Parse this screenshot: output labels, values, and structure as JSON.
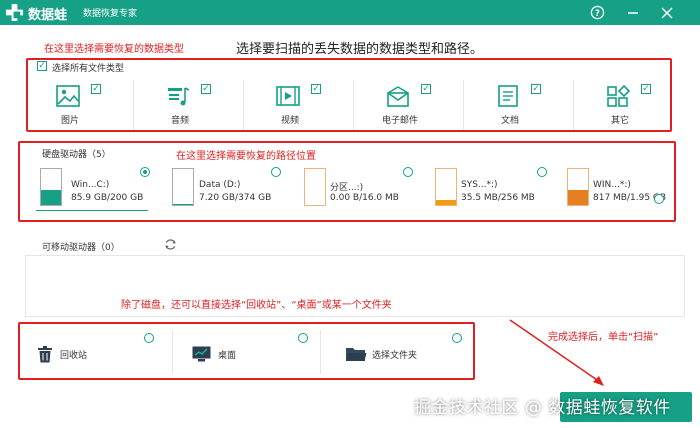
{
  "app": {
    "name": "数据蛙",
    "subtitle": "数据恢复专家",
    "controls": [
      "help-icon",
      "minimize-icon",
      "close-icon"
    ],
    "brand_color": "#16a085"
  },
  "heading": "选择要扫描的丢失数据的数据类型和路径。",
  "annotations": {
    "type_hint": "在这里选择需要恢复的数据类型",
    "path_hint": "在这里选择需要恢复的路径位置",
    "location_hint": "除了磁盘，还可以直接选择“回收站”、“桌面”或某一个文件夹",
    "scan_hint": "完成选择后，单击“扫描”",
    "color": "#e02020"
  },
  "file_types": {
    "select_all_label": "选择所有文件类型",
    "select_all_checked": true,
    "items": [
      {
        "label": "图片",
        "icon": "image-icon",
        "checked": true
      },
      {
        "label": "音频",
        "icon": "music-icon",
        "checked": true
      },
      {
        "label": "视频",
        "icon": "video-icon",
        "checked": true
      },
      {
        "label": "电子邮件",
        "icon": "email-icon",
        "checked": true
      },
      {
        "label": "文档",
        "icon": "document-icon",
        "checked": true
      },
      {
        "label": "其它",
        "icon": "other-icon",
        "checked": true
      }
    ]
  },
  "hard_drives": {
    "title": "硬盘驱动器（5）",
    "items": [
      {
        "name": "Win...C:)",
        "size": "85.9 GB/200 GB",
        "used_fraction": 0.43,
        "fill_color": "#16a085",
        "selected": true
      },
      {
        "name": "Data (D:)",
        "size": "7.20 GB/374 GB",
        "used_fraction": 0.02,
        "fill_color": "#16a085",
        "selected": false
      },
      {
        "name": "分区...:)",
        "size": "0.00  B/16.0 MB",
        "used_fraction": 0.0,
        "fill_color": "#16a085",
        "selected": false
      },
      {
        "name": "SYS...*:)",
        "size": "35.5 MB/256 MB",
        "used_fraction": 0.14,
        "fill_color": "#f39c12",
        "selected": false
      },
      {
        "name": "WIN...*:)",
        "size": "817 MB/1.95 GB",
        "used_fraction": 0.42,
        "fill_color": "#e67e22",
        "selected": false
      }
    ]
  },
  "removable": {
    "title": "可移动驱动器（0）",
    "refresh_icon": "refresh-icon"
  },
  "locations": [
    {
      "label": "回收站",
      "icon": "recycle-bin-icon",
      "selected": false
    },
    {
      "label": "桌面",
      "icon": "desktop-icon",
      "selected": false
    },
    {
      "label": "选择文件夹",
      "icon": "folder-icon",
      "selected": false
    }
  ],
  "watermark": "掘金技术社区 @ 数据蛙恢复软件"
}
